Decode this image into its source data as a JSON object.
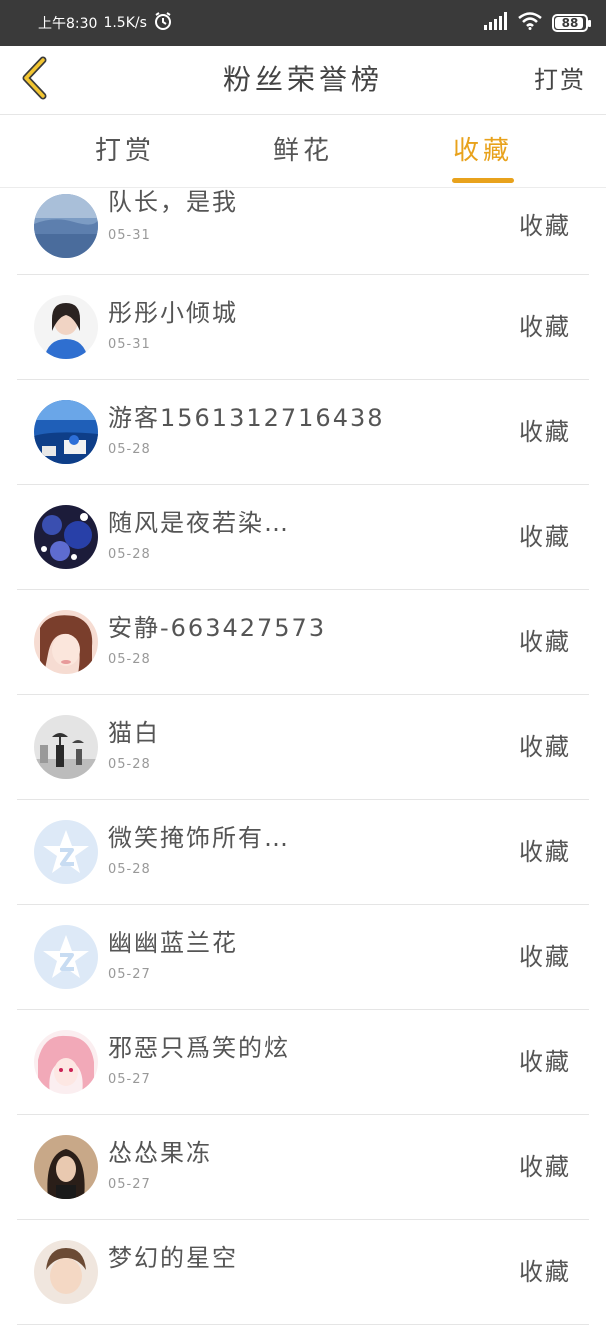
{
  "status_bar": {
    "time": "上午8:30",
    "speed": "1.5K/s",
    "battery": "88"
  },
  "header": {
    "title": "粉丝荣誉榜",
    "right_label": "打赏"
  },
  "tabs": [
    {
      "label": "打赏",
      "active": false
    },
    {
      "label": "鲜花",
      "active": false
    },
    {
      "label": "收藏",
      "active": true
    }
  ],
  "accent_color": "#e8a21c",
  "list": [
    {
      "name": "队长，是我",
      "date": "05-31",
      "action": "收藏",
      "avatar": "photo-sea"
    },
    {
      "name": "彤彤小倾城",
      "date": "05-31",
      "action": "收藏",
      "avatar": "photo-girl-blue"
    },
    {
      "name": "游客1561312716438",
      "date": "05-28",
      "action": "收藏",
      "avatar": "photo-santorini"
    },
    {
      "name": "随风是夜若染…",
      "date": "05-28",
      "action": "收藏",
      "avatar": "photo-dark-blue"
    },
    {
      "name": "安静-663427573",
      "date": "05-28",
      "action": "收藏",
      "avatar": "photo-girl-pink"
    },
    {
      "name": "猫白",
      "date": "05-28",
      "action": "收藏",
      "avatar": "photo-umbrella"
    },
    {
      "name": "微笑掩饰所有…",
      "date": "05-28",
      "action": "收藏",
      "avatar": "qq-default"
    },
    {
      "name": "幽幽蓝兰花",
      "date": "05-27",
      "action": "收藏",
      "avatar": "qq-default"
    },
    {
      "name": "邪惡只爲笑的炫",
      "date": "05-27",
      "action": "收藏",
      "avatar": "photo-anime-pink"
    },
    {
      "name": "怂怂果冻",
      "date": "05-27",
      "action": "收藏",
      "avatar": "photo-girl-dark"
    },
    {
      "name": "梦幻的星空",
      "date": "",
      "action": "收藏",
      "avatar": "photo-boy"
    }
  ]
}
